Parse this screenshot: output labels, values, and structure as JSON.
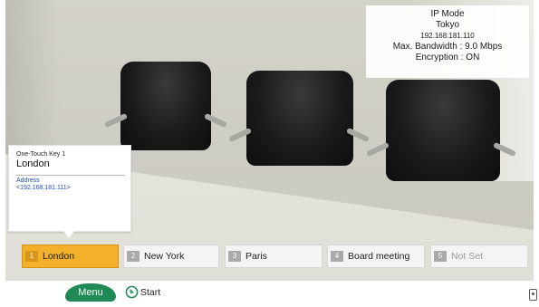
{
  "info_panel": {
    "mode": "IP Mode",
    "site": "Tokyo",
    "ip": "192.168.181.110",
    "bandwidth": "Max. Bandwidth : 9.0 Mbps",
    "encryption": "Encryption : ON"
  },
  "tooltip": {
    "heading": "One-Touch Key 1",
    "name": "London",
    "address_label": "Address",
    "address": "<192.168.181.111>"
  },
  "keys": [
    {
      "num": "1",
      "label": "London",
      "selected": true
    },
    {
      "num": "2",
      "label": "New York",
      "selected": false
    },
    {
      "num": "3",
      "label": "Paris",
      "selected": false
    },
    {
      "num": "4",
      "label": "Board meeting",
      "selected": false
    },
    {
      "num": "5",
      "label": "Not Set",
      "selected": false
    }
  ],
  "bottom": {
    "menu_label": "Menu",
    "start_label": "Start"
  },
  "colors": {
    "selected_key": "#f2b02b",
    "menu_button": "#1e8a55",
    "address_text": "#1f4fb8"
  },
  "icons": {
    "start": "start-circle-arrow-icon",
    "corner": "device-status-icon"
  }
}
